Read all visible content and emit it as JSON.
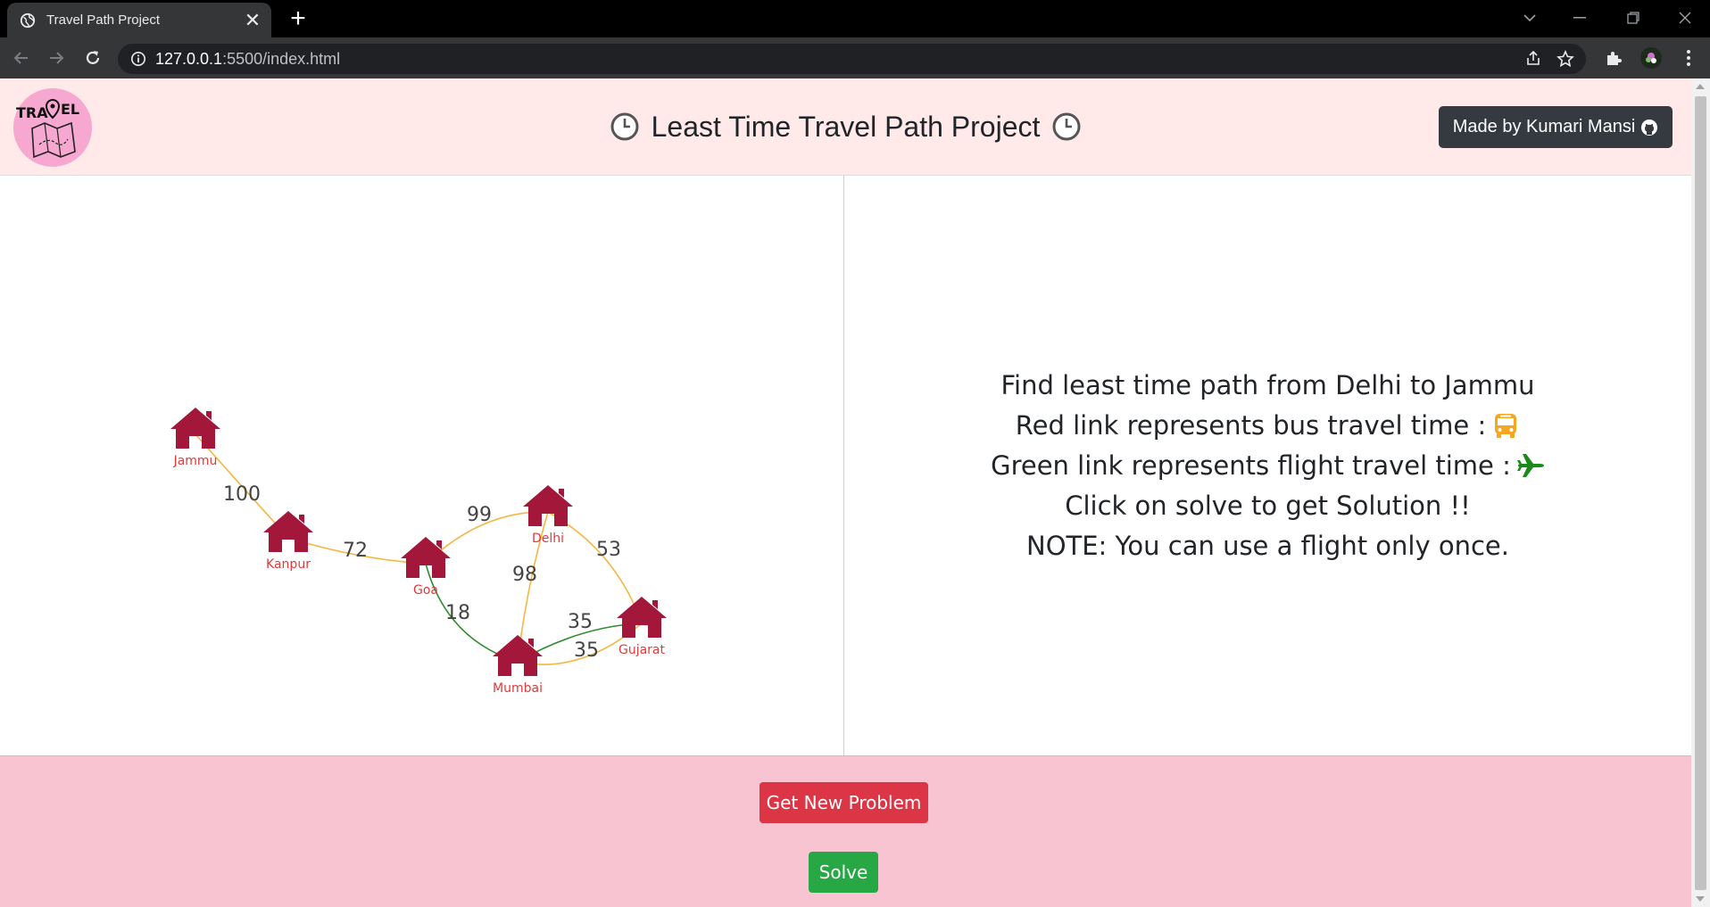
{
  "browser": {
    "tab_title": "Travel Path Project",
    "url_host": "127.0.0.1",
    "url_rest": ":5500/index.html"
  },
  "header": {
    "logo_text_left": "TRA",
    "logo_text_right": "EL",
    "title": "Least Time Travel Path Project",
    "made_by": "Made by Kumari Mansi"
  },
  "graph": {
    "nodes": [
      {
        "id": "jammu",
        "label": "Jammu"
      },
      {
        "id": "kanpur",
        "label": "Kanpur"
      },
      {
        "id": "goa",
        "label": "Goa"
      },
      {
        "id": "delhi",
        "label": "Delhi"
      },
      {
        "id": "mumbai",
        "label": "Mumbai"
      },
      {
        "id": "gujarat",
        "label": "Gujarat"
      }
    ],
    "edges": [
      {
        "from": "Jammu",
        "to": "Kanpur",
        "weight": "100",
        "mode": "bus"
      },
      {
        "from": "Kanpur",
        "to": "Goa",
        "weight": "72",
        "mode": "bus"
      },
      {
        "from": "Goa",
        "to": "Delhi",
        "weight": "99",
        "mode": "bus"
      },
      {
        "from": "Delhi",
        "to": "Gujarat",
        "weight": "53",
        "mode": "bus"
      },
      {
        "from": "Delhi",
        "to": "Mumbai",
        "weight": "98",
        "mode": "bus"
      },
      {
        "from": "Goa",
        "to": "Mumbai",
        "weight": "18",
        "mode": "flight"
      },
      {
        "from": "Mumbai",
        "to": "Gujarat",
        "weight": "35",
        "mode": "flight"
      },
      {
        "from": "Mumbai",
        "to": "Gujarat",
        "weight": "35",
        "mode": "bus"
      }
    ],
    "colors": {
      "bus": "#f5b742",
      "flight": "#2e8b2e",
      "house": "#a3173a",
      "label": "#e03a3a"
    }
  },
  "instructions": {
    "line1": "Find least time path from Delhi to Jammu",
    "line2": "Red link represents bus travel time :",
    "line3": "Green link represents flight travel time :",
    "line4": "Click on solve to get Solution !!",
    "line5": "NOTE: You can use a flight only once."
  },
  "actions": {
    "new_problem": "Get New Problem",
    "solve": "Solve"
  },
  "theme": {
    "header_bg": "#ffe9e9",
    "footer_bg": "#f8c4d2",
    "danger": "#dc3545",
    "success": "#28a745",
    "dark": "#343a40"
  }
}
